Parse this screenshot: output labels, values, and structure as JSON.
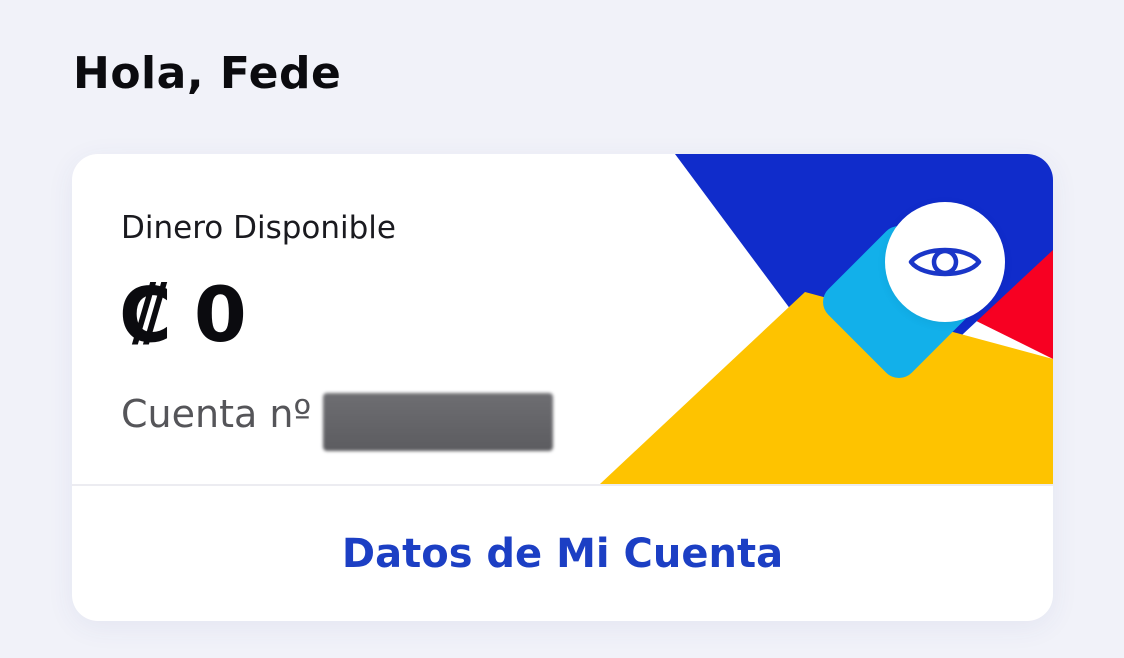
{
  "header": {
    "greeting": "Hola, Fede"
  },
  "balance_card": {
    "label": "Dinero Disponible",
    "currency_symbol": "₡",
    "amount": "0",
    "account_label": "Cuenta nº",
    "toggle_icon": "eye-icon",
    "link_label": "Datos de Mi Cuenta"
  },
  "colors": {
    "page_background": "#f1f2f9",
    "brand_blue": "#102ccb",
    "brand_cyan": "#12b0ea",
    "brand_yellow": "#fec300",
    "brand_red": "#f70022",
    "link_blue": "#1c3fc4"
  }
}
